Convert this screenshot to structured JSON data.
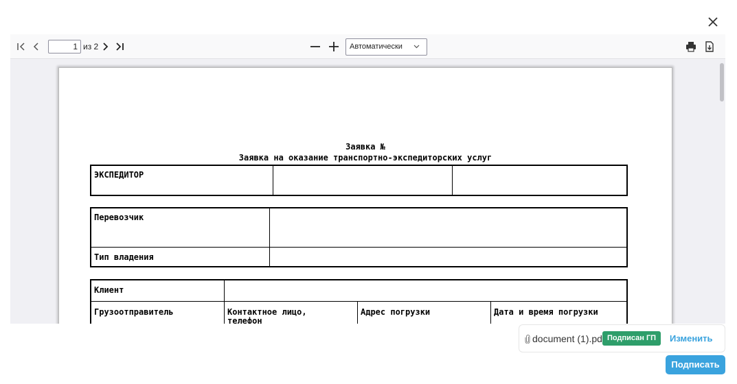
{
  "viewer": {
    "current_page": "1",
    "page_count_text": "из 2",
    "zoom_value": "Автоматически"
  },
  "document": {
    "heading": "Заявка №",
    "subheading": "Заявка на оказание транспортно-экспедиторских услуг",
    "forwarder_label": "ЭКСПЕДИТОР",
    "carrier_label": "Перевозчик",
    "ownership_label": "Тип владения",
    "client_label": "Клиент",
    "shipper_label": "Грузоотправитель",
    "contact_label": "Контактное лицо,",
    "contact_label_2": "телефон",
    "loading_address_label": "Адрес погрузки",
    "loading_datetime_label": "Дата и время погрузки"
  },
  "file": {
    "name": "document (1).pdf",
    "status_badge": "Подписан ГП",
    "change_label": "Изменить"
  },
  "actions": {
    "sign_label": "Подписать"
  },
  "colors": {
    "badge": "#2e9e6a",
    "accent": "#3aa3de"
  }
}
